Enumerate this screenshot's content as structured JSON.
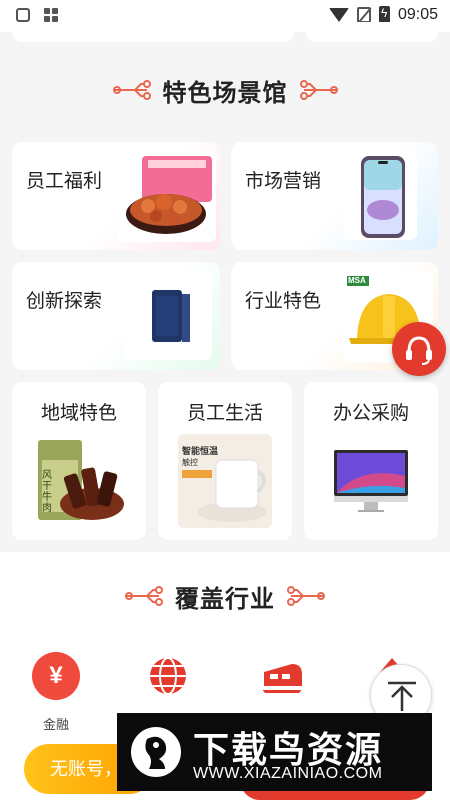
{
  "status_bar": {
    "time": "09:05"
  },
  "scenes_section": {
    "title": "特色场景馆",
    "cards": [
      {
        "label": "员工福利"
      },
      {
        "label": "市场营销"
      },
      {
        "label": "创新探索"
      },
      {
        "label": "行业特色"
      },
      {
        "label": "地域特色"
      },
      {
        "label": "员工生活"
      },
      {
        "label": "办公采购"
      }
    ],
    "product_texts": {
      "helmet_brand": "MSA",
      "beef_jerky": "风干牛肉",
      "cup_text": "智能恒温",
      "cup_sub": "触控"
    }
  },
  "industries_section": {
    "title": "覆盖行业",
    "items": [
      {
        "label": "金融",
        "icon": "yuan-icon"
      },
      {
        "label": "",
        "icon": "globe-icon"
      },
      {
        "label": "",
        "icon": "train-icon"
      },
      {
        "label": "",
        "icon": "tower-icon"
      }
    ]
  },
  "bottom_bar": {
    "no_account_label": "无账号，"
  },
  "watermark": {
    "title": "下载鸟资源",
    "url": "WWW.XIAZAINIAO.COM"
  },
  "colors": {
    "accent": "#e23b2e",
    "yellow": "#ffa000"
  }
}
